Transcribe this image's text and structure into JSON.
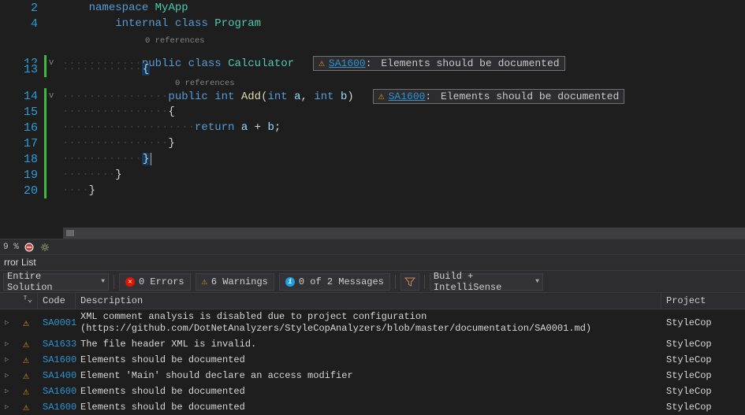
{
  "editor": {
    "lines": [
      {
        "num": 2,
        "fold": "",
        "green": false,
        "tokens": [
          [
            "    ",
            ""
          ],
          [
            "namespace",
            "kw-blue"
          ],
          [
            " ",
            ""
          ],
          [
            "MyApp",
            "kw-class"
          ]
        ]
      },
      {
        "num": 4,
        "fold": "",
        "green": false,
        "tokens": [
          [
            "        ",
            ""
          ],
          [
            "internal",
            "kw-blue"
          ],
          [
            " ",
            ""
          ],
          [
            "class",
            "kw-blue"
          ],
          [
            " ",
            ""
          ],
          [
            "Program",
            "kw-class"
          ]
        ]
      }
    ],
    "ref_labels": {
      "calc": "0 references",
      "add": "0 references"
    },
    "body_lines": [
      {
        "num": 12,
        "fold": "v",
        "green": true,
        "indent": "············",
        "code": [
          [
            "public",
            "kw-blue"
          ],
          [
            " ",
            ""
          ],
          [
            "class",
            "kw-blue"
          ],
          [
            " ",
            ""
          ],
          [
            "Calculator",
            "kw-class"
          ]
        ],
        "warn_key": "w1"
      },
      {
        "num": 13,
        "fold": "",
        "green": true,
        "indent": "············",
        "code": [
          [
            "{",
            "brace-hl"
          ]
        ]
      },
      {
        "num": 14,
        "fold": "v",
        "green": true,
        "indent": "················",
        "code": [
          [
            "public",
            "kw-blue"
          ],
          [
            " ",
            ""
          ],
          [
            "int",
            "kw-blue"
          ],
          [
            " ",
            ""
          ],
          [
            "Add",
            "kw-method"
          ],
          [
            "(",
            "punct"
          ],
          [
            "int",
            "kw-blue"
          ],
          [
            " ",
            ""
          ],
          [
            "a",
            "kw-param"
          ],
          [
            ",",
            "punct"
          ],
          [
            " ",
            ""
          ],
          [
            "int",
            "kw-blue"
          ],
          [
            " ",
            ""
          ],
          [
            "b",
            "kw-param"
          ],
          [
            ")",
            "punct"
          ]
        ],
        "warn_key": "w2"
      },
      {
        "num": 15,
        "fold": "",
        "green": true,
        "indent": "················",
        "code": [
          [
            "{",
            "punct"
          ]
        ]
      },
      {
        "num": 16,
        "fold": "",
        "green": true,
        "indent": "····················",
        "code": [
          [
            "return",
            "kw-blue"
          ],
          [
            " ",
            ""
          ],
          [
            "a",
            "kw-param"
          ],
          [
            " + ",
            "punct"
          ],
          [
            "b",
            "kw-param"
          ],
          [
            ";",
            "punct"
          ]
        ]
      },
      {
        "num": 17,
        "fold": "",
        "green": true,
        "indent": "················",
        "code": [
          [
            "}",
            "punct"
          ]
        ]
      },
      {
        "num": 18,
        "fold": "",
        "green": true,
        "indent": "············",
        "code": [
          [
            "}",
            "brace-hl"
          ]
        ],
        "cursor": true
      },
      {
        "num": 19,
        "fold": "",
        "green": true,
        "indent": "········",
        "code": [
          [
            "}",
            "punct"
          ]
        ]
      },
      {
        "num": 20,
        "fold": "",
        "green": true,
        "indent": "····",
        "code": [
          [
            "}",
            "punct"
          ]
        ]
      }
    ],
    "inline_warnings": {
      "w1": {
        "code": "SA1600",
        "msg": "Elements should be documented"
      },
      "w2": {
        "code": "SA1600",
        "msg": "Elements should be documented"
      }
    }
  },
  "status": {
    "zoom": "9 %"
  },
  "panel": {
    "title": "rror List",
    "scope": "Entire Solution",
    "errors": "0 Errors",
    "warnings": "6 Warnings",
    "messages": "0 of 2 Messages",
    "build_mode": "Build + IntelliSense",
    "columns": {
      "code": "Code",
      "description": "Description",
      "project": "Project"
    },
    "rows": [
      {
        "code": "SA0001",
        "desc": "XML comment analysis is disabled due to project configuration (https://github.com/DotNetAnalyzers/StyleCopAnalyzers/blob/master/documentation/SA0001.md)",
        "project": "StyleCop"
      },
      {
        "code": "SA1633",
        "desc": "The file header XML is invalid.",
        "project": "StyleCop"
      },
      {
        "code": "SA1600",
        "desc": "Elements should be documented",
        "project": "StyleCop"
      },
      {
        "code": "SA1400",
        "desc": "Element 'Main' should declare an access modifier",
        "project": "StyleCop"
      },
      {
        "code": "SA1600",
        "desc": "Elements should be documented",
        "project": "StyleCop"
      },
      {
        "code": "SA1600",
        "desc": "Elements should be documented",
        "project": "StyleCop"
      }
    ]
  }
}
